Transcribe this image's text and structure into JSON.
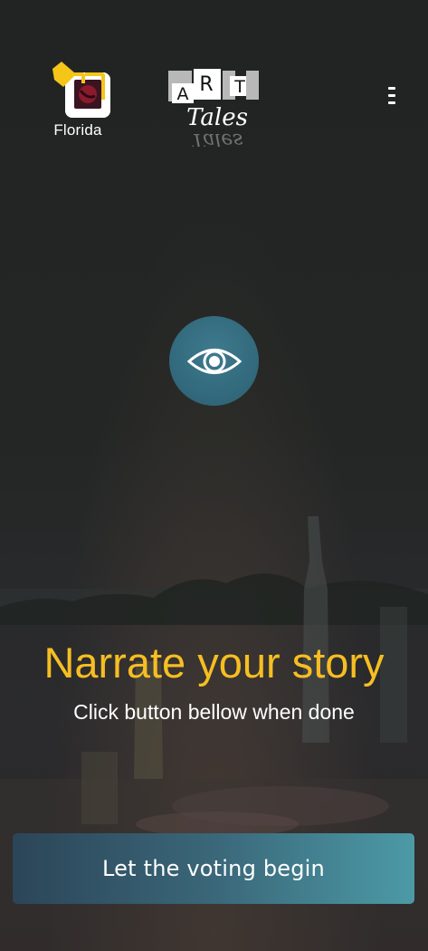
{
  "header": {
    "location_label": "Florida",
    "location_icon": "location-badge-icon",
    "logo_letters": [
      "A",
      "R",
      "T"
    ],
    "logo_word": "Tales",
    "menu_icon": "vertical-ellipsis-icon"
  },
  "main": {
    "view_icon": "eye-icon",
    "headline": "Narrate your story",
    "subline": "Click button bellow when done"
  },
  "footer": {
    "vote_button_label": "Let the voting begin"
  },
  "colors": {
    "headline": "#f6be22",
    "accent_teal": "#336a7d",
    "button_gradient_start": "#2c4558",
    "button_gradient_end": "#4c9aa6",
    "badge_yellow": "#f5c518"
  }
}
